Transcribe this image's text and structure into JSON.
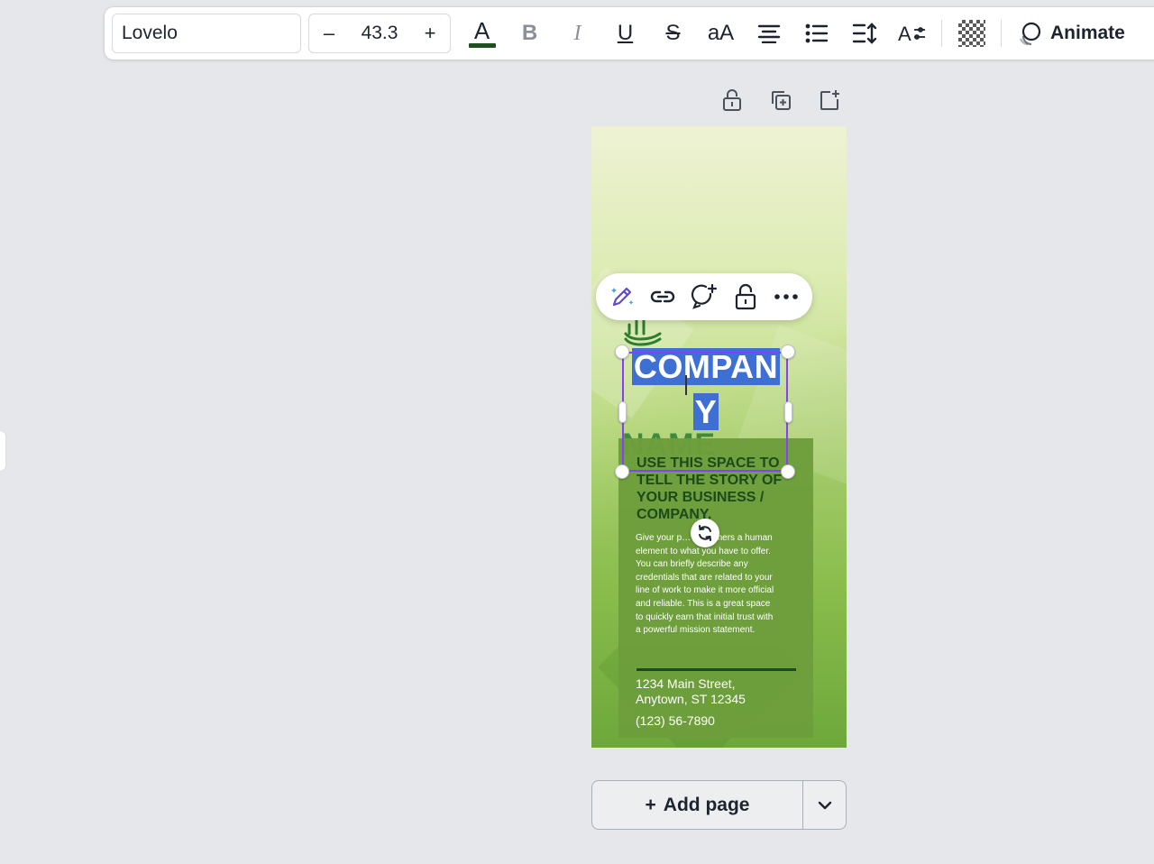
{
  "toolbar": {
    "font_name": "Lovelo",
    "font_size": "43.3",
    "decrease_label": "–",
    "increase_label": "+",
    "text_color_letter": "A",
    "bold_label": "B",
    "italic_label": "I",
    "underline_label": "U",
    "strike_label": "S",
    "case_label": "aA",
    "animate_label": "Animate"
  },
  "design": {
    "heading_line1": "COMPAN",
    "heading_line2": "Y",
    "ghost_name": "NAME",
    "story_title": "USE THIS SPACE TO TELL THE STORY OF YOUR BUSINESS / COMPANY.",
    "story_body": "Give your p… customers a human element to what you have to offer. You can briefly describe any credentials that are related to your line of work to make it more official and reliable. This is a great space to quickly earn that initial trust with a powerful mission statement.",
    "address_line1": "1234 Main Street,",
    "address_line2": "Anytown, ST 12345",
    "phone": "(123) 56-7890"
  },
  "footer": {
    "add_page_label": "Add page",
    "add_page_plus": "+"
  },
  "colors": {
    "selection": "#8b3dff",
    "text_highlight": "#3d6fd4",
    "box_green": "#6d9e3c",
    "dark_green": "#1c4a1c"
  }
}
